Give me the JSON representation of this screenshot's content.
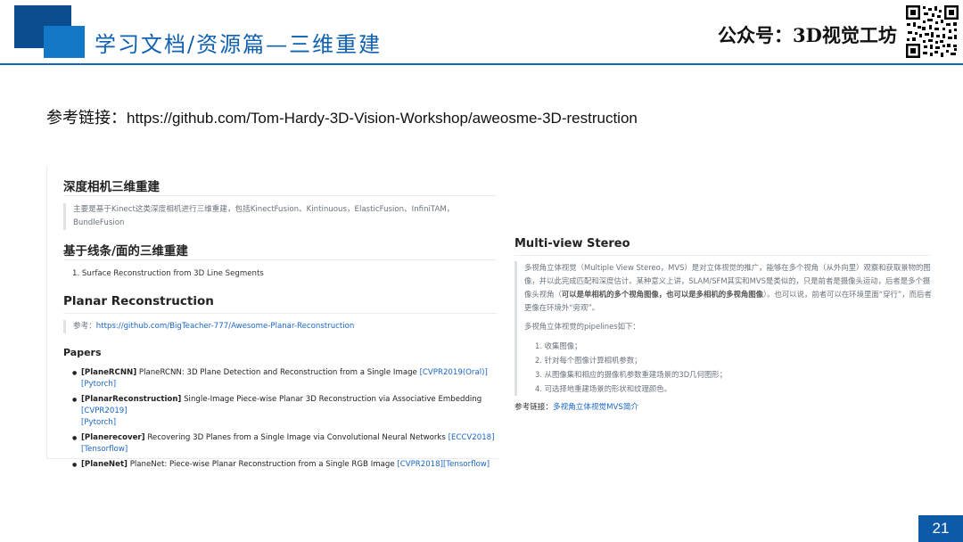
{
  "header": {
    "title": "学习文档/资源篇—三维重建",
    "publisher": "公众号：3D视觉工坊",
    "qr_icon": "qr-code-icon",
    "colors": {
      "brand_dark": "#0c4d8f",
      "brand": "#1478c8",
      "rule": "#1266b4"
    }
  },
  "reference": {
    "label": "参考链接：",
    "url": "https://github.com/Tom-Hardy-3D-Vision-Workshop/aweosme-3D-restruction"
  },
  "left": {
    "section1": {
      "title": "深度相机三维重建",
      "quote_line1": "主要是基于Kinect这类深度相机进行三维重建，包括KinectFusion、Kintinuous，ElasticFusion、InfiniTAM，",
      "quote_line2": "BundleFusion"
    },
    "section2": {
      "title": "基于线条/面的三维重建",
      "item1": "1. Surface Reconstruction from 3D Line Segments"
    },
    "section3": {
      "title": "Planar Reconstruction",
      "ref_label": "参考：",
      "ref_url": "https://github.com/BigTeacher-777/Awesome-Planar-Reconstruction"
    },
    "papers": {
      "title": "Papers",
      "p1": {
        "tag": "[PlaneRCNN]",
        "text": " PlaneRCNN: 3D Plane Detection and Reconstruction from a Single Image ",
        "link1": "[CVPR2019(Oral)]",
        "link2": "[Pytorch]"
      },
      "p2": {
        "tag": "[PlanarReconstruction]",
        "text": " Single-Image Piece-wise Planar 3D Reconstruction via Associative Embedding ",
        "link1": "[CVPR2019]",
        "link2": "[Pytorch]"
      },
      "p3": {
        "tag": "[Planerecover]",
        "text": " Recovering 3D Planes from a Single Image via Convolutional Neural Networks ",
        "link1": "[ECCV2018]",
        "link2": "[Tensorflow]"
      },
      "p4": {
        "tag": "[PlaneNet]",
        "text": " PlaneNet: Piece-wise Planar Reconstruction from a Single RGB Image ",
        "link1": "[CVPR2018]",
        "link2": "[Tensorflow]"
      }
    }
  },
  "right": {
    "title": "Multi-view Stereo",
    "para1_a": "多视角立体视觉（Multiple View Stereo，MVS）是对立体视觉的推广，能够在多个视角（从外向里）观察和获取景物的图像，并以此完成匹配和深度估计。某种意义上讲，SLAM/SFM其实和MVS是类似的，只是前者是摄像头运动，后者是多个摄像头视角（",
    "para1_bold": "可以是单相机的多个视角图像，也可以是多相机的多视角图像",
    "para1_b": "）。也可以说，前者可以在环境里面“穿行”，而后者更像在环境外“旁观”。",
    "para2": "多视角立体视觉的pipelines如下：",
    "steps": [
      "1. 收集图像；",
      "2. 针对每个图像计算相机参数；",
      "3. 从图像集和相应的摄像机参数重建场景的3D几何图形；",
      "4. 可选择地重建场景的形状和纹理颜色。"
    ],
    "ref_label": "参考链接：",
    "ref_link": "多视角立体视觉MVS简介"
  },
  "page_number": "21"
}
